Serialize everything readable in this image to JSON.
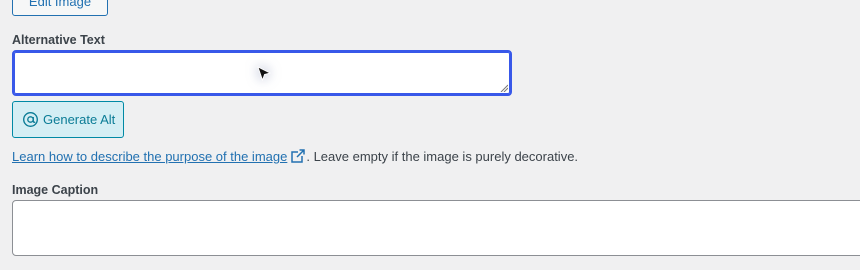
{
  "edit_image": {
    "label": "Edit Image"
  },
  "alt_text": {
    "label": "Alternative Text",
    "value": ""
  },
  "generate_alt": {
    "label": "Generate Alt",
    "icon": "at-sign-icon"
  },
  "help": {
    "link_text": "Learn how to describe the purpose of the image",
    "link_icon": "external-link-icon",
    "suffix": ". Leave empty if the image is purely decorative."
  },
  "caption": {
    "label": "Image Caption",
    "value": ""
  },
  "colors": {
    "focus_border": "#3858e9",
    "link": "#2271b1",
    "generate_bg": "#d4eef4",
    "generate_text": "#0b7c96",
    "page_bg": "#f0f0f1"
  }
}
